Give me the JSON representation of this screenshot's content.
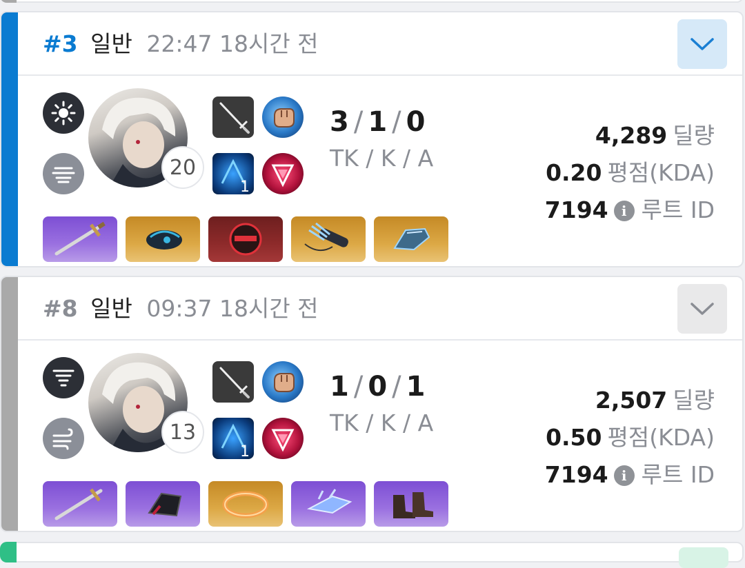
{
  "matches": [
    {
      "rank": "#3",
      "mode": "일반",
      "duration": "22:47",
      "ago": "18시간 전",
      "accent_color": "#0a7bd1",
      "rank_color": "#0a7bd1",
      "toggle_bg": "#d6e9f8",
      "toggle_color": "#1a7fd3",
      "expanded": false,
      "skill_icons": [
        "sun-icon",
        "cloud-icon"
      ],
      "level": "20",
      "weapon_skill_level": "1",
      "kda": {
        "tk": "3",
        "k": "1",
        "a": "0"
      },
      "kda_label": "TK / K / A",
      "damage": "4,289",
      "damage_label": "딜량",
      "score": "0.20",
      "score_label": "평점(KDA)",
      "route_id": "7194",
      "route_label": "루트 ID",
      "items": [
        {
          "name": "sword-item-icon",
          "tier": "purple"
        },
        {
          "name": "dragon-armor-item-icon",
          "tier": "gold"
        },
        {
          "name": "helmet-item-icon",
          "tier": "red"
        },
        {
          "name": "quiver-item-icon",
          "tier": "gold"
        },
        {
          "name": "gauntlet-item-icon",
          "tier": "gold"
        }
      ]
    },
    {
      "rank": "#8",
      "mode": "일반",
      "duration": "09:37",
      "ago": "18시간 전",
      "accent_color": "#a9a9a9",
      "rank_color": "#8a8d94",
      "toggle_bg": "#e9e9ea",
      "toggle_color": "#8a8d94",
      "expanded": false,
      "skill_icons": [
        "tornado-icon",
        "wind-icon"
      ],
      "level": "13",
      "weapon_skill_level": "1",
      "kda": {
        "tk": "1",
        "k": "0",
        "a": "1"
      },
      "kda_label": "TK / K / A",
      "damage": "2,507",
      "damage_label": "딜량",
      "score": "0.50",
      "score_label": "평점(KDA)",
      "route_id": "7194",
      "route_label": "루트 ID",
      "items": [
        {
          "name": "sword-item-icon",
          "tier": "purple"
        },
        {
          "name": "armor-item-icon",
          "tier": "purple"
        },
        {
          "name": "ring-item-icon",
          "tier": "gold"
        },
        {
          "name": "crystal-blade-item-icon",
          "tier": "purple"
        },
        {
          "name": "boots-item-icon",
          "tier": "purple"
        }
      ]
    }
  ]
}
